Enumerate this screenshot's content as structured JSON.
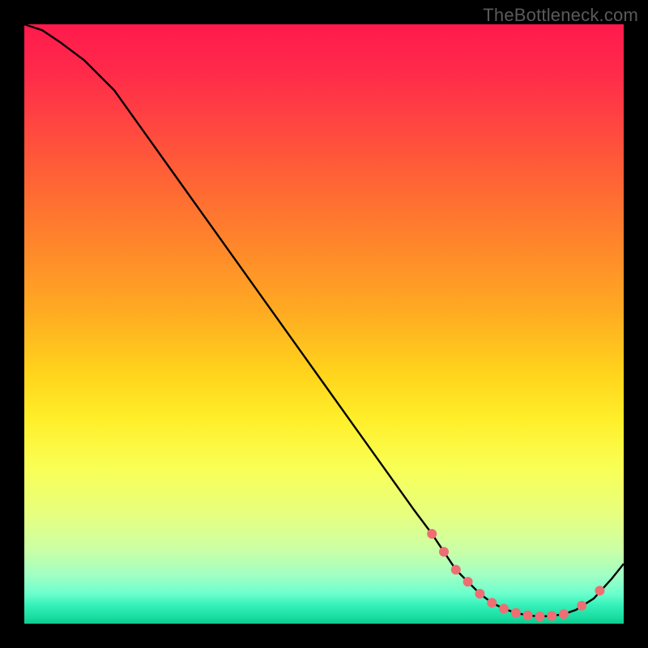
{
  "watermark": "TheBottleneck.com",
  "colors": {
    "frame_bg": "#000000",
    "line": "#000000",
    "marker": "#ef6e74",
    "gradient_top": "#ff1a4d",
    "gradient_bottom": "#10c98f"
  },
  "chart_data": {
    "type": "line",
    "title": "",
    "xlabel": "",
    "ylabel": "",
    "xlim": [
      0,
      100
    ],
    "ylim": [
      0,
      100
    ],
    "x": [
      0,
      3,
      6,
      10,
      15,
      20,
      25,
      30,
      35,
      40,
      45,
      50,
      55,
      60,
      65,
      68,
      70,
      72,
      74,
      76,
      78,
      80,
      82,
      84,
      86,
      88,
      90,
      92,
      95,
      98,
      100
    ],
    "values": [
      100,
      99,
      97,
      94,
      89,
      82,
      75,
      68,
      61,
      54,
      47,
      40,
      33,
      26,
      19,
      15,
      12,
      9,
      7,
      5,
      3.5,
      2.5,
      1.8,
      1.4,
      1.2,
      1.3,
      1.6,
      2.3,
      4.2,
      7.5,
      10
    ],
    "marker_points": {
      "x": [
        68,
        70,
        72,
        74,
        76,
        78,
        80,
        82,
        84,
        86,
        88,
        90,
        93,
        96
      ],
      "values": [
        15,
        12,
        9,
        7,
        5,
        3.5,
        2.5,
        1.8,
        1.4,
        1.2,
        1.3,
        1.6,
        3.0,
        5.5
      ]
    }
  }
}
